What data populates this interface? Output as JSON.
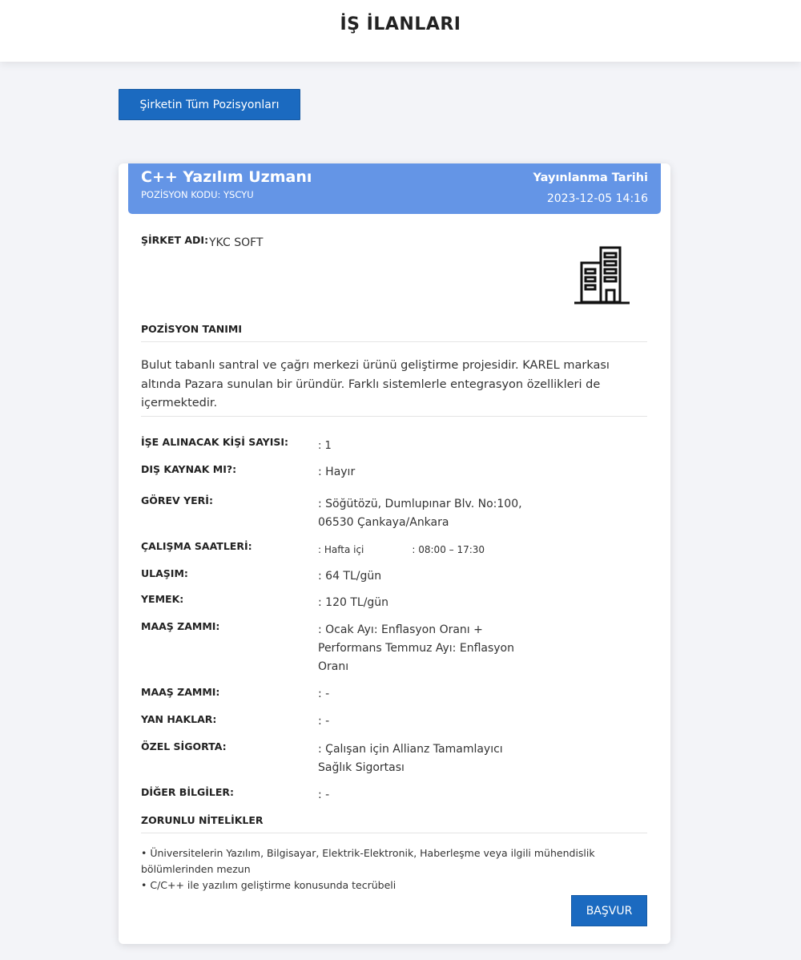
{
  "page": {
    "title": "İŞ İLANLARI"
  },
  "toolbar": {
    "all_positions_label": "Şirketin Tüm Pozisyonları"
  },
  "job": {
    "title": "C++ Yazılım Uzmanı",
    "code": "POZİSYON KODU: YSCYU",
    "published_label": "Yayınlanma Tarihi",
    "published_date": "2023-12-05 14:16",
    "company_label": "ŞİRKET ADI:",
    "company_name": "YKC SOFT",
    "company_icon": "building-icon",
    "position_definition_title": "POZİSYON TANIMI",
    "position_definition": "Bulut tabanlı santral ve çağrı merkezi ürünü geliştirme projesidir. KAREL markası altında Pazara sunulan bir üründür. Farklı sistemlerle entegrasyon özellikleri de içermektedir.",
    "details": {
      "headcount_label": "İŞE ALINACAK KİŞİ SAYISI:",
      "headcount_value": ": 1",
      "outsource_label": "DIŞ KAYNAK MI?:",
      "outsource_value": ": Hayır",
      "location_label": "GÖREV YERİ:",
      "location_value_1": ": Söğütözü, Dumlupınar Blv. No:100,",
      "location_value_2": "06530 Çankaya/Ankara",
      "hours_label": "ÇALIŞMA SAATLERİ:",
      "hours_day": ": Hafta içi",
      "hours_time": ": 08:00 – 17:30",
      "transport_label": "ULAŞIM:",
      "transport_value": ": 64 TL/gün",
      "meal_label": "YEMEK:",
      "meal_value": ": 120 TL/gün",
      "raise_label": "MAAŞ ZAMMI:",
      "raise_value_1": ": Ocak Ayı: Enflasyon Oranı +",
      "raise_value_2": "Performans Temmuz Ayı: Enflasyon",
      "raise_value_3": "Oranı",
      "raise2_label": "MAAŞ ZAMMI:",
      "raise2_value": ": -",
      "benefits_label": "YAN HAKLAR:",
      "benefits_value": ": -",
      "insurance_label": "ÖZEL SİGORTA:",
      "insurance_value_1": ": Çalışan için Allianz Tamamlayıcı",
      "insurance_value_2": "Sağlık Sigortası",
      "other_label": "DİĞER BİLGİLER:",
      "other_value": ": -"
    },
    "requirements_title": "ZORUNLU NİTELİKLER",
    "requirements": [
      "• Üniversitelerin Yazılım, Bilgisayar, Elektrik-Elektronik, Haberleşme veya ilgili mühendislik bölümlerinden mezun",
      "• C/C++ ile yazılım geliştirme konusunda tecrübeli"
    ],
    "apply_label": "BAŞVUR"
  }
}
